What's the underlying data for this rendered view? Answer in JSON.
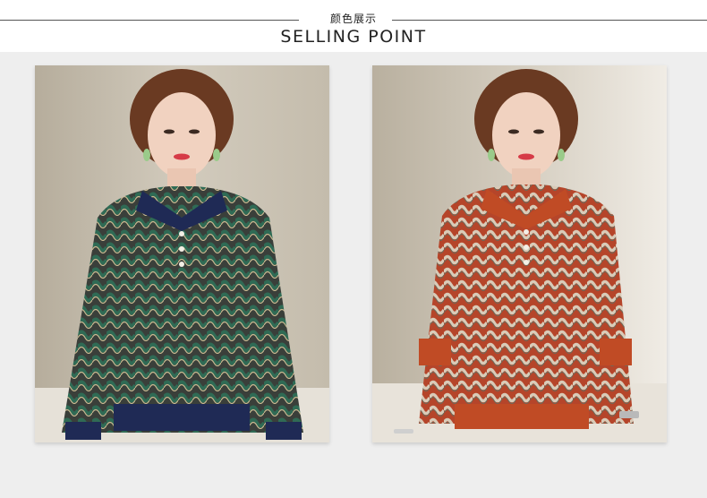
{
  "header": {
    "subtitle": "颜色展示",
    "title": "SELLING POINT"
  },
  "products": [
    {
      "id": "navy-green-pattern",
      "colors": {
        "body": "#3a3f3a",
        "accent": "#2f6b55",
        "trim": "#1f2a55",
        "collar": "#1f2a55"
      }
    },
    {
      "id": "rust-red-pattern",
      "colors": {
        "body": "#b5452a",
        "accent": "#d9cbb8",
        "trim": "#c04b25",
        "collar": "#c04b25"
      }
    }
  ]
}
